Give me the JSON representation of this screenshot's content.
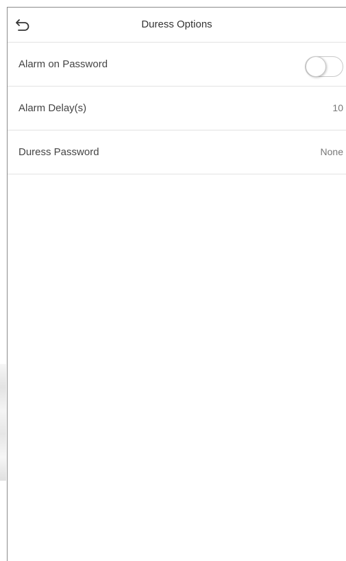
{
  "header": {
    "title": "Duress Options",
    "back_icon": "back-arrow-icon"
  },
  "settings": [
    {
      "label": "Alarm on Password",
      "type": "toggle",
      "enabled": false
    },
    {
      "label": "Alarm Delay(s)",
      "type": "value",
      "value": "10"
    },
    {
      "label": "Duress Password",
      "type": "value",
      "value": "None"
    }
  ],
  "colors": {
    "divider": "#e2e2e2",
    "text": "#444444",
    "value_text": "#777777",
    "toggle_border": "#c8c8c8"
  }
}
